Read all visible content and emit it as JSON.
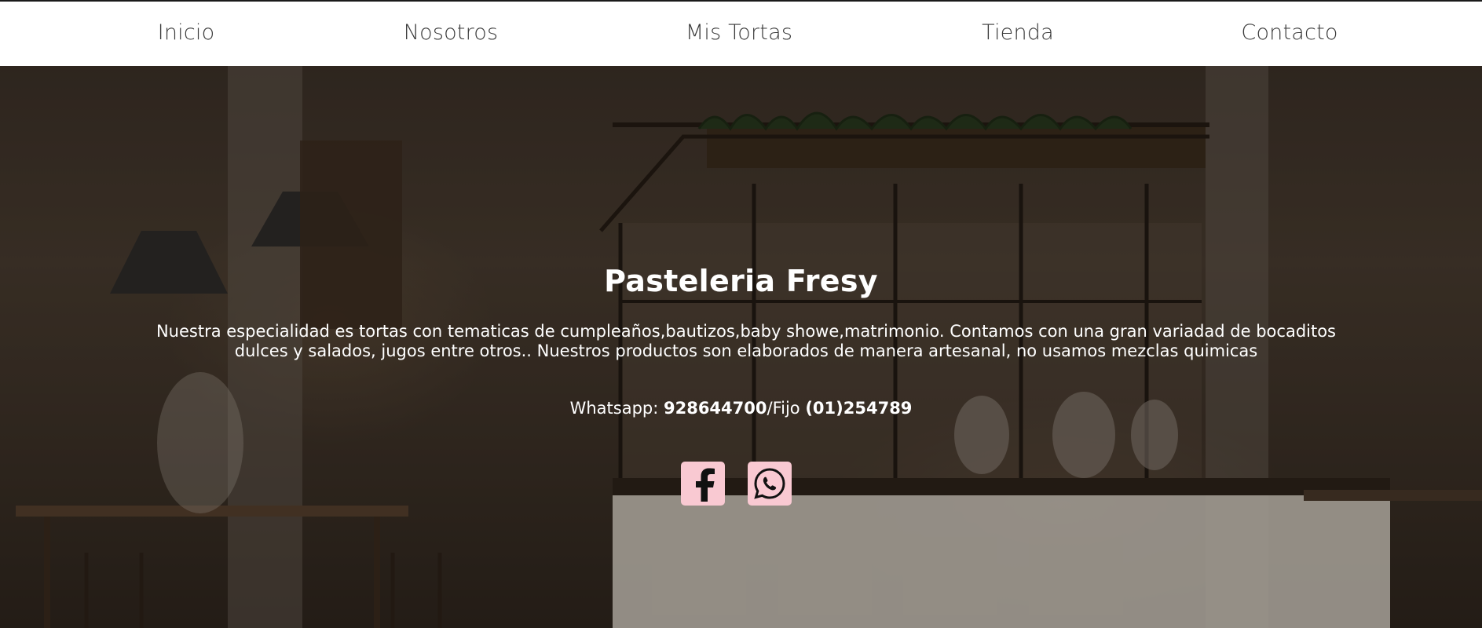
{
  "nav": {
    "items": [
      {
        "label": "Inicio"
      },
      {
        "label": "Nosotros"
      },
      {
        "label": "Mis Tortas"
      },
      {
        "label": "Tienda"
      },
      {
        "label": "Contacto"
      }
    ]
  },
  "hero": {
    "title": "Pasteleria Fresy",
    "description": "Nuestra especialidad es tortas con tematicas de cumpleaños,bautizos,baby showe,matrimonio. Contamos con una gran variadad de bocaditos dulces y salados, jugos entre otros.. Nuestros productos son elaborados de manera artesanal, no usamos mezclas quimicas",
    "whatsapp_label": "Whatsapp: ",
    "whatsapp_number": "928644700",
    "separator": "/",
    "landline_label": "Fijo ",
    "landline_number": "(01)254789"
  },
  "social": {
    "facebook_icon": "facebook-icon",
    "whatsapp_icon": "whatsapp-icon"
  },
  "colors": {
    "social_bg": "#f9c9d2",
    "nav_text": "#3a3a3a",
    "hero_text": "#ffffff"
  }
}
